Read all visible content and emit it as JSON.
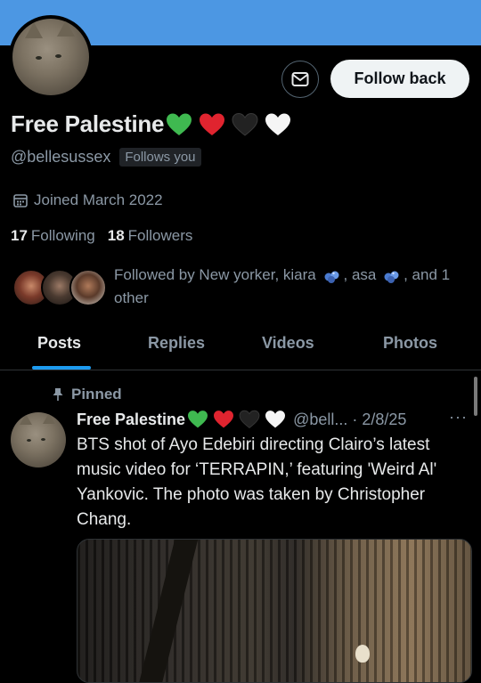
{
  "profile": {
    "display_name": "Free Palestine",
    "handle": "@bellesussex",
    "follows_you": "Follows you",
    "joined": "Joined March 2022",
    "following_count": "17",
    "following_label": "Following",
    "followers_count": "18",
    "followers_label": "Followers",
    "followed_by_prefix": "Followed by New yorker, kiara",
    "followed_by_mid": ", asa",
    "followed_by_suffix": ", and 1 other"
  },
  "actions": {
    "follow_back": "Follow back"
  },
  "tabs": [
    {
      "label": "Posts"
    },
    {
      "label": "Replies"
    },
    {
      "label": "Videos"
    },
    {
      "label": "Photos"
    }
  ],
  "post": {
    "pinned_label": "Pinned",
    "author": "Free Palestine",
    "meta": "@bell... · 2/8/25",
    "more": "···",
    "text": "BTS shot of Ayo Edebiri directing Clairo’s latest music video for ‘TERRAPIN,’ featuring 'Weird Al' Yankovic. The photo was taken by Christopher Chang."
  },
  "colors": {
    "banner": "#4c97e3",
    "accent": "#1d9bf0",
    "heart_green": "#3fb950",
    "heart_red": "#e0242f",
    "heart_black": "#1a1a1a",
    "heart_white": "#f5f5f5"
  },
  "icons": [
    "mail-icon",
    "calendar-icon",
    "pin-icon",
    "heart-icon",
    "gem-icon",
    "more-icon"
  ]
}
